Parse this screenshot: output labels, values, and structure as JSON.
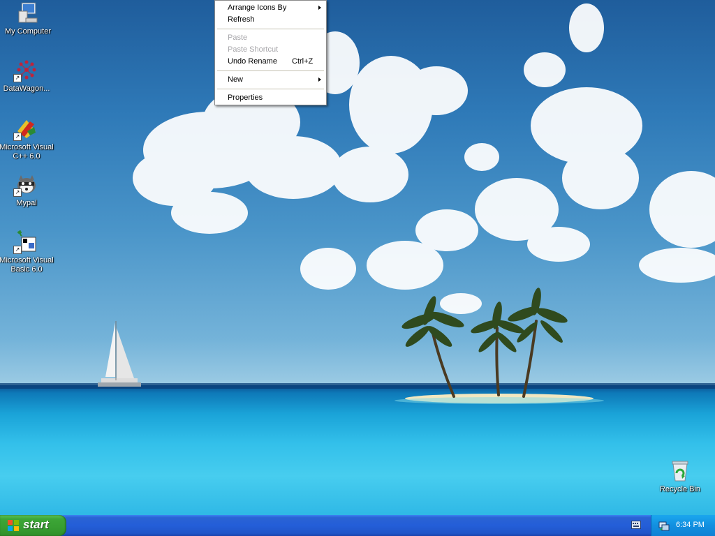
{
  "desktop": {
    "icons": [
      {
        "label": "My Computer",
        "icon": "my-computer-icon"
      },
      {
        "label": "DataWagon...",
        "icon": "datawagon-icon"
      },
      {
        "label": "Microsoft Visual C++ 6.0",
        "icon": "visual-cpp-icon"
      },
      {
        "label": "Mypal",
        "icon": "mypal-icon"
      },
      {
        "label": "Microsoft Visual Basic 6.0",
        "icon": "visual-basic-icon"
      },
      {
        "label": "Recycle Bin",
        "icon": "recycle-bin-icon"
      }
    ]
  },
  "context_menu": {
    "items": [
      {
        "label": "Arrange Icons By",
        "submenu": true,
        "enabled": true
      },
      {
        "label": "Refresh",
        "enabled": true
      },
      {
        "label": "Paste",
        "enabled": false
      },
      {
        "label": "Paste Shortcut",
        "enabled": false
      },
      {
        "label": "Undo Rename",
        "shortcut": "Ctrl+Z",
        "enabled": true
      },
      {
        "label": "New",
        "submenu": true,
        "enabled": true
      },
      {
        "label": "Properties",
        "enabled": true
      }
    ]
  },
  "taskbar": {
    "start_label": "start",
    "clock": "6:34 PM"
  },
  "colors": {
    "taskbar": "#245ed8",
    "start_button": "#3da637",
    "tray": "#1290e0",
    "menu_disabled_text": "#a7a6aa"
  }
}
